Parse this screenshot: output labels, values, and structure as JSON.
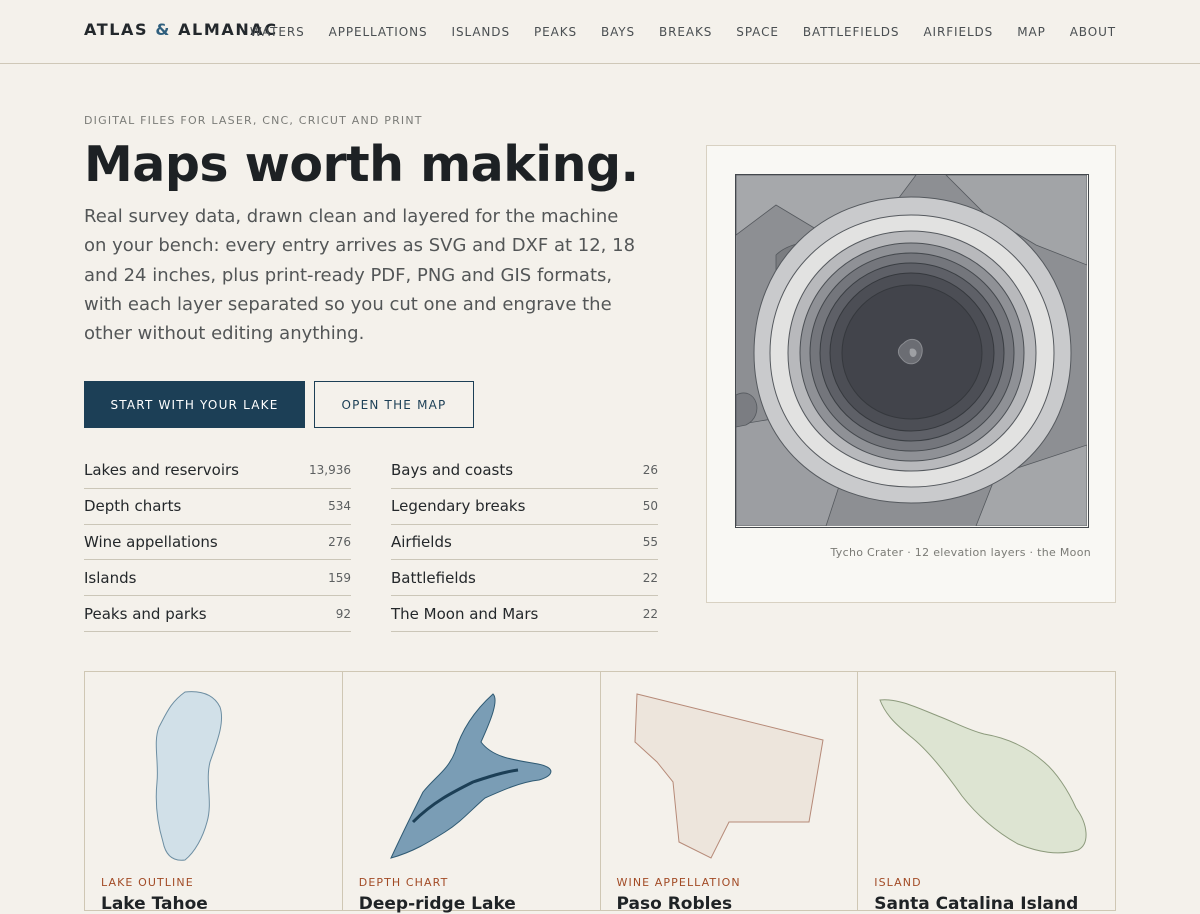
{
  "header": {
    "brand_left": "ATLAS",
    "brand_amp": "&",
    "brand_right": "ALMANAC",
    "nav": [
      "WATERS",
      "APPELLATIONS",
      "ISLANDS",
      "PEAKS",
      "BAYS",
      "BREAKS",
      "SPACE",
      "BATTLEFIELDS",
      "AIRFIELDS",
      "MAP",
      "ABOUT"
    ]
  },
  "hero": {
    "eyebrow": "DIGITAL FILES FOR LASER, CNC, CRICUT AND PRINT",
    "title": "Maps worth making.",
    "body": "Real survey data, drawn clean and layered for the machine on your bench: every entry arrives as SVG and DXF at 12, 18 and 24 inches, plus print-ready PDF, PNG and GIS formats, with each layer separated so you cut one and engrave the other without editing anything.",
    "primary_cta": "START WITH YOUR LAKE",
    "secondary_cta": "OPEN THE MAP"
  },
  "categories_left": [
    {
      "name": "Lakes and reservoirs",
      "count": "13,936"
    },
    {
      "name": "Depth charts",
      "count": "534"
    },
    {
      "name": "Wine appellations",
      "count": "276"
    },
    {
      "name": "Islands",
      "count": "159"
    },
    {
      "name": "Peaks and parks",
      "count": "92"
    }
  ],
  "categories_right": [
    {
      "name": "Bays and coasts",
      "count": "26"
    },
    {
      "name": "Legendary breaks",
      "count": "50"
    },
    {
      "name": "Airfields",
      "count": "55"
    },
    {
      "name": "Battlefields",
      "count": "22"
    },
    {
      "name": "The Moon and Mars",
      "count": "22"
    }
  ],
  "feature": {
    "caption": "Tycho Crater · 12 elevation layers · the Moon"
  },
  "cards": [
    {
      "kicker": "LAKE OUTLINE",
      "title": "Lake Tahoe",
      "fill": "#d1e0e8",
      "stroke": "#6d8ea2"
    },
    {
      "kicker": "DEPTH CHART",
      "title": "Deep-ridge Lake",
      "fill": "#7a9db5",
      "stroke": "#2f5a73"
    },
    {
      "kicker": "WINE APPELLATION",
      "title": "Paso Robles",
      "fill": "#ede5dc",
      "stroke": "#b68a78"
    },
    {
      "kicker": "ISLAND",
      "title": "Santa Catalina Island",
      "fill": "#dde4d2",
      "stroke": "#8c9a7c"
    }
  ],
  "colors": {
    "background": "#f4f1eb",
    "primary": "#1c3f56",
    "accent_kicker": "#a24b26"
  }
}
